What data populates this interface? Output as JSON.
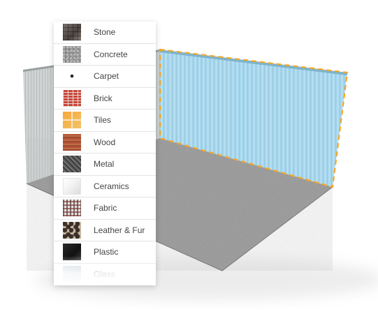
{
  "materials_panel": {
    "items": [
      {
        "label": "Stone",
        "icon": "stone-texture-icon"
      },
      {
        "label": "Concrete",
        "icon": "concrete-texture-icon"
      },
      {
        "label": "Carpet",
        "icon": "carpet-texture-icon"
      },
      {
        "label": "Brick",
        "icon": "brick-texture-icon"
      },
      {
        "label": "Tiles",
        "icon": "tiles-texture-icon"
      },
      {
        "label": "Wood",
        "icon": "wood-texture-icon"
      },
      {
        "label": "Metal",
        "icon": "metal-texture-icon"
      },
      {
        "label": "Ceramics",
        "icon": "ceramics-texture-icon"
      },
      {
        "label": "Fabric",
        "icon": "fabric-texture-icon"
      },
      {
        "label": "Leather & Fur",
        "icon": "leather-texture-icon"
      },
      {
        "label": "Plastic",
        "icon": "plastic-texture-icon"
      },
      {
        "label": "Glass",
        "icon": "glass-texture-icon"
      }
    ]
  },
  "scene": {
    "selected_surface": "back-wall",
    "selection_color": "#f5a623",
    "wall_color": "#a9d8ee",
    "floor_color": "#8a8a8a"
  }
}
